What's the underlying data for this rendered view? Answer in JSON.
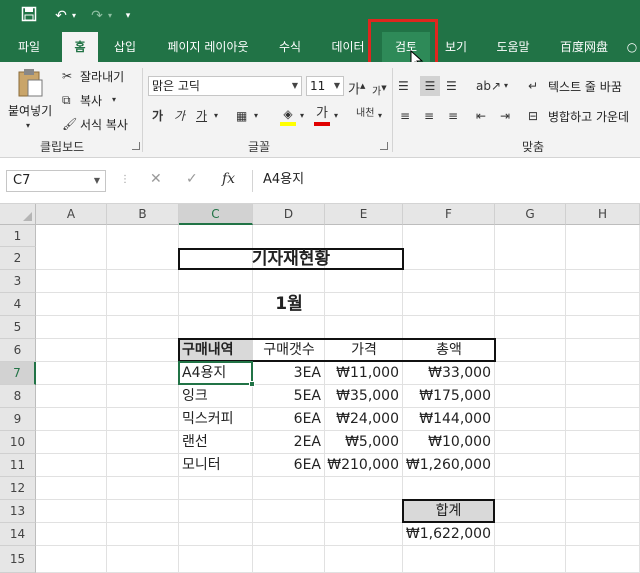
{
  "title_bar": {
    "save_icon": "save-icon",
    "undo_icon": "undo-icon",
    "redo_icon": "redo-icon",
    "customize_icon": "customize-qat-icon"
  },
  "tabs": [
    "파일",
    "홈",
    "삽입",
    "페이지 레이아웃",
    "수식",
    "데이터",
    "검토",
    "보기",
    "도움말",
    "百度网盘"
  ],
  "active_tab": "홈",
  "hover_tab": "검토",
  "ribbon": {
    "clipboard": {
      "paste_label": "붙여넣기",
      "cut_label": "잘라내기",
      "copy_label": "복사",
      "format_painter_label": "서식 복사",
      "group_label": "클립보드"
    },
    "font": {
      "font_name": "맑은 고딕",
      "font_size": "11",
      "bold": "가",
      "italic": "가",
      "underline": "가",
      "group_label": "글꼴"
    },
    "alignment": {
      "wrap_text_label": "텍스트 줄 바꿈",
      "merge_label": "병합하고 가운데",
      "group_label": "맞춤"
    }
  },
  "formula_bar": {
    "name_box": "C7",
    "cancel_icon": "cancel-icon",
    "enter_icon": "enter-icon",
    "fx_label": "fx",
    "content": "A4용지"
  },
  "columns": [
    "A",
    "B",
    "C",
    "D",
    "E",
    "F",
    "G",
    "H"
  ],
  "rows": [
    "1",
    "2",
    "3",
    "4",
    "5",
    "6",
    "7",
    "8",
    "9",
    "10",
    "11",
    "12",
    "13",
    "14",
    "15"
  ],
  "selected_cell": "C7",
  "sheet": {
    "title": "기자재현황",
    "month": "1월",
    "headers": [
      "구매내역",
      "구매갯수",
      "가격",
      "총액"
    ],
    "items": [
      [
        "A4용지",
        "3EA",
        "₩11,000",
        "₩33,000"
      ],
      [
        "잉크",
        "5EA",
        "₩35,000",
        "₩175,000"
      ],
      [
        "믹스커피",
        "6EA",
        "₩24,000",
        "₩144,000"
      ],
      [
        "랜선",
        "2EA",
        "₩5,000",
        "₩10,000"
      ],
      [
        "모니터",
        "6EA",
        "₩210,000",
        "₩1,260,000"
      ]
    ],
    "total_label": "합계",
    "total_value": "₩1,622,000"
  },
  "colors": {
    "excel_green": "#217346",
    "highlight_red": "#e0261e",
    "header_fill": "#d9d9d9"
  }
}
